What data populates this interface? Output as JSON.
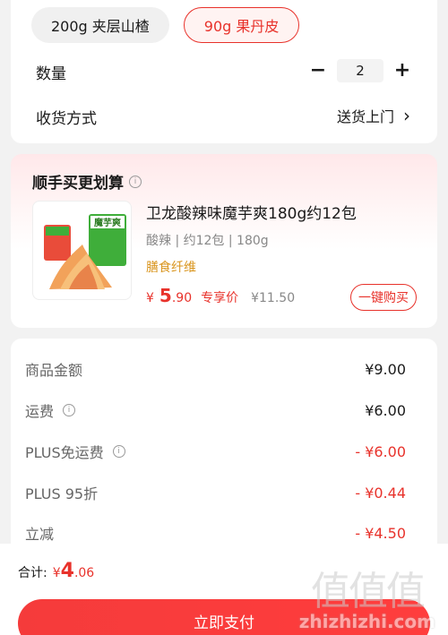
{
  "spec_options": [
    {
      "label": "200g  夹层山楂",
      "selected": false
    },
    {
      "label": "90g  果丹皮",
      "selected": true
    }
  ],
  "quantity": {
    "label": "数量",
    "minus": "−",
    "value": "2",
    "plus": "+"
  },
  "delivery": {
    "label": "收货方式",
    "value": "送货上门",
    "chevron": "›"
  },
  "recommend": {
    "title": "顺手买更划算",
    "info_icon": "ⓘ",
    "product": {
      "name": "卫龙酸辣味魔芋爽180g约12包",
      "spec": "酸辣 | 约12包 | 180g",
      "tag": "膳食纤维",
      "price_symbol": "¥",
      "price_int": "5",
      "price_dec": ".90",
      "price_label": "专享价",
      "original_price": "¥11.50",
      "buy_label": "一键购买",
      "image_text": "魔芋爽"
    }
  },
  "summary": {
    "rows": [
      {
        "label": "商品金额",
        "value": "¥9.00",
        "info": false,
        "red": false
      },
      {
        "label": "运费",
        "value": "¥6.00",
        "info": true,
        "red": false
      },
      {
        "label": "PLUS免运费",
        "value": "- ¥6.00",
        "info": true,
        "red": true
      },
      {
        "label": "PLUS 95折",
        "value": "- ¥0.44",
        "info": false,
        "red": true
      },
      {
        "label": "立减",
        "value": "- ¥4.50",
        "info": false,
        "red": true
      }
    ]
  },
  "bottom": {
    "total_label": "合计:",
    "total_symbol": "¥",
    "total_int": "4",
    "total_dec": ".06",
    "pay_label": "立即支付"
  },
  "watermark": {
    "logo": "值值值",
    "text": "zhizhizhi.com"
  },
  "colors": {
    "accent": "#e8322b",
    "tag": "#d9941c"
  }
}
